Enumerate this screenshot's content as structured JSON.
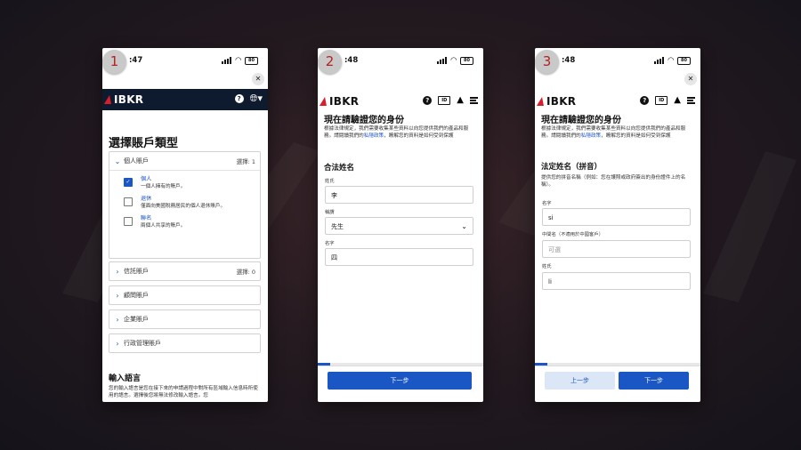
{
  "screens": [
    {
      "step": "1",
      "time_suffix": ":47",
      "battery": "80",
      "logo": "IBKR",
      "title": "選擇賬戶類型",
      "accounts": {
        "individual": {
          "label": "個人賬戶",
          "count": "選擇: 1"
        },
        "options": [
          {
            "title": "個人",
            "desc": "一個人擁有的賬戶。",
            "checked": true
          },
          {
            "title": "退休",
            "desc": "僅面向美國稅務居民的個人退休賬戶。",
            "checked": false
          },
          {
            "title": "聯名",
            "desc": "兩個人共享的賬戶。",
            "checked": false
          }
        ],
        "trust": {
          "label": "信託賬戶",
          "count": "選擇: 0"
        },
        "others": [
          "顧問賬戶",
          "企業賬戶",
          "行政管理賬戶"
        ]
      },
      "lang_title": "輸入語言",
      "lang_text": "您的輸入語言是您在接下來的申請過程中對所有區域輸入信息時所使用的語言。選擇後您將無法修改輸入語言。您"
    },
    {
      "step": "2",
      "time_suffix": ":48",
      "battery": "80",
      "logo": "IBKR",
      "title": "現在請驗證您的身份",
      "intro_1": "根據法律規定，我們需要收集某些資料以向您提供我們的產品和服務。請閱讀我們的",
      "intro_link": "私隱政策",
      "intro_2": "，瞭解您的資料是如何受到保護",
      "section": "合法姓名",
      "fields": [
        {
          "label": "姓氏",
          "value": "李"
        },
        {
          "label": "稱謂",
          "value": "先生"
        },
        {
          "label": "名字",
          "value": "四"
        }
      ],
      "next": "下一步"
    },
    {
      "step": "3",
      "time_suffix": ":48",
      "battery": "80",
      "logo": "IBKR",
      "title": "現在請驗證您的身份",
      "intro_1": "根據法律規定，我們需要收集某些資料以向您提供我們的產品和服務。請閱讀我們的",
      "intro_link": "私隱政策",
      "intro_2": "，瞭解您的資料是如何受到保護",
      "section": "法定姓名（拼音）",
      "hint": "提供您的拼音名稱（例如：您在護照或政府簽出的身份證件上的名稱）。",
      "fields": [
        {
          "label": "名字",
          "value": "si",
          "placeholder": ""
        },
        {
          "label": "中間名（不適用於中國客戶）",
          "value": "",
          "placeholder": "可選"
        },
        {
          "label": "姓氏",
          "value": "li",
          "placeholder": ""
        }
      ],
      "back": "上一步",
      "next": "下一步"
    }
  ],
  "icons": {
    "close": "close-icon",
    "help": "help-icon",
    "globe": "globe-icon",
    "id_card": "id-card-icon",
    "user": "user-icon",
    "menu": "menu-icon"
  },
  "colors": {
    "accent": "#1a56c4",
    "header_dark": "#0e1b2e",
    "badge_number": "#b3221d",
    "logo_mark": "#d81e2b"
  }
}
